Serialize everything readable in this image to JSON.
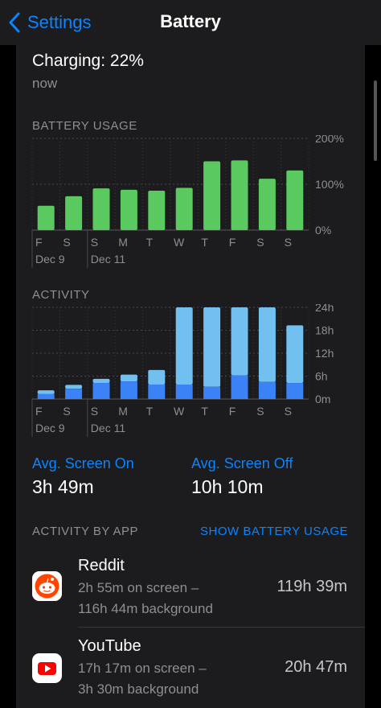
{
  "nav": {
    "back_label": "Settings",
    "title": "Battery"
  },
  "charging": {
    "title": "Charging: 22%",
    "subtitle": "now"
  },
  "battery_usage": {
    "label": "BATTERY USAGE",
    "y_ticks": [
      "200%",
      "100%",
      "0%"
    ],
    "day_labels": [
      "F",
      "S",
      "S",
      "M",
      "T",
      "W",
      "T",
      "F",
      "S",
      "S"
    ],
    "date_labels": [
      {
        "index": 0,
        "text": "Dec 9"
      },
      {
        "index": 2,
        "text": "Dec 11"
      }
    ]
  },
  "activity": {
    "label": "ACTIVITY",
    "y_ticks": [
      "24h",
      "18h",
      "12h",
      "6h",
      "0m"
    ],
    "day_labels": [
      "F",
      "S",
      "S",
      "M",
      "T",
      "W",
      "T",
      "F",
      "S",
      "S"
    ],
    "date_labels": [
      {
        "index": 0,
        "text": "Dec 9"
      },
      {
        "index": 2,
        "text": "Dec 11"
      }
    ]
  },
  "stats": {
    "screen_on_label": "Avg. Screen On",
    "screen_on_value": "3h 49m",
    "screen_off_label": "Avg. Screen Off",
    "screen_off_value": "10h 10m"
  },
  "activity_by_app": {
    "label": "ACTIVITY BY APP",
    "link": "SHOW BATTERY USAGE"
  },
  "apps": [
    {
      "name": "Reddit",
      "icon": "reddit-icon",
      "detail_1": "2h 55m on screen –",
      "detail_2": "116h 44m background",
      "total": "119h 39m"
    },
    {
      "name": "YouTube",
      "icon": "youtube-icon",
      "detail_1": "17h 17m on screen –",
      "detail_2": "3h 30m background",
      "total": "20h 47m"
    }
  ],
  "colors": {
    "accent": "#0a84ff",
    "battery_bar": "#5ac95f",
    "screen_on": "#3a82f6",
    "screen_off": "#72c0ef"
  },
  "chart_data": [
    {
      "type": "bar",
      "title": "BATTERY USAGE",
      "categories": [
        "F",
        "S",
        "S",
        "M",
        "T",
        "W",
        "T",
        "F",
        "S",
        "S"
      ],
      "values": [
        53,
        74,
        91,
        88,
        86,
        92,
        150,
        152,
        112,
        130
      ],
      "ylim": [
        0,
        200
      ],
      "y_unit": "%"
    },
    {
      "type": "bar",
      "title": "ACTIVITY",
      "stacked": true,
      "categories": [
        "F",
        "S",
        "S",
        "M",
        "T",
        "W",
        "T",
        "F",
        "S",
        "S"
      ],
      "series": [
        {
          "name": "Screen On",
          "values": [
            1.3,
            2.7,
            4.2,
            4.6,
            3.8,
            3.8,
            3.2,
            6.2,
            4.5,
            4.2
          ]
        },
        {
          "name": "Screen Off",
          "values": [
            1.0,
            1.0,
            1.1,
            1.8,
            3.8,
            20.2,
            20.8,
            17.8,
            19.5,
            15.1
          ]
        }
      ],
      "ylim": [
        0,
        24
      ],
      "y_unit": "h"
    }
  ]
}
